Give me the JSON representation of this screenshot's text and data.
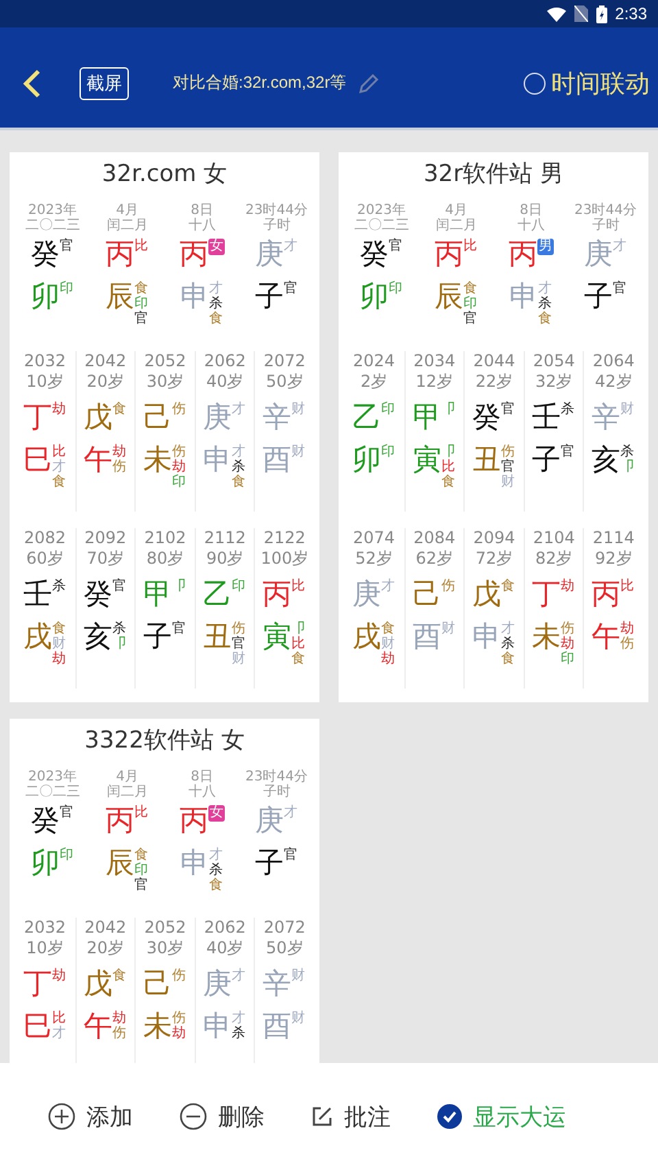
{
  "status_bar": {
    "time": "2:33"
  },
  "header": {
    "screenshot_button": "截屏",
    "title": "对比合婚:32r.com,32r等",
    "time_link": {
      "label": "时间联动",
      "checked": false
    }
  },
  "cards": [
    {
      "title": "32r.com 女",
      "pillars": [
        {
          "lines": [
            "2023年",
            "二〇二三"
          ],
          "stem": {
            "char": "癸",
            "color": "#111111",
            "tags": [
              {
                "text": "官",
                "color": "#333333"
              }
            ]
          },
          "branch": {
            "char": "卯",
            "color": "#1e9a1e",
            "tags": [
              {
                "text": "印",
                "color": "#3aa63a"
              }
            ]
          }
        },
        {
          "lines": [
            "4月",
            "闰二月"
          ],
          "stem": {
            "char": "丙",
            "color": "#e8262a",
            "tags": [
              {
                "text": "比",
                "color": "#e8262a"
              }
            ]
          },
          "branch": {
            "char": "辰",
            "color": "#a06c12",
            "tags": [
              {
                "text": "食",
                "color": "#b08030"
              },
              {
                "text": "印",
                "color": "#3aa63a"
              },
              {
                "text": "官",
                "color": "#333333"
              }
            ]
          }
        },
        {
          "lines": [
            "8日",
            "十八"
          ],
          "stem": {
            "char": "丙",
            "color": "#e8262a",
            "badge": {
              "text": "女",
              "color": "#e0409a"
            }
          },
          "branch": {
            "char": "申",
            "color": "#98a4b8",
            "tags": [
              {
                "text": "才",
                "color": "#a0aac0"
              },
              {
                "text": "杀",
                "color": "#222222"
              },
              {
                "text": "食",
                "color": "#b08030"
              }
            ]
          }
        },
        {
          "lines": [
            "23时44分",
            "子时"
          ],
          "stem": {
            "char": "庚",
            "color": "#98a4b8",
            "tags": [
              {
                "text": "才",
                "color": "#a0aac0"
              }
            ]
          },
          "branch": {
            "char": "子",
            "color": "#111111",
            "tags": [
              {
                "text": "官",
                "color": "#333333"
              }
            ]
          }
        }
      ],
      "dayun": [
        [
          {
            "year": "2032",
            "age": "10岁",
            "stem": {
              "char": "丁",
              "color": "#e8262a",
              "tags": [
                {
                  "text": "劫",
                  "color": "#e8262a"
                }
              ]
            },
            "branch": {
              "char": "巳",
              "color": "#e8262a",
              "tags": [
                {
                  "text": "比",
                  "color": "#e8262a"
                },
                {
                  "text": "才",
                  "color": "#a0aac0"
                },
                {
                  "text": "食",
                  "color": "#b08030"
                }
              ]
            }
          },
          {
            "year": "2042",
            "age": "20岁",
            "stem": {
              "char": "戊",
              "color": "#a06c12",
              "tags": [
                {
                  "text": "食",
                  "color": "#b08030"
                }
              ]
            },
            "branch": {
              "char": "午",
              "color": "#e8262a",
              "tags": [
                {
                  "text": "劫",
                  "color": "#e8262a"
                },
                {
                  "text": "伤",
                  "color": "#b08030"
                }
              ]
            }
          },
          {
            "year": "2052",
            "age": "30岁",
            "stem": {
              "char": "己",
              "color": "#a06c12",
              "tags": [
                {
                  "text": "伤",
                  "color": "#b08030"
                }
              ]
            },
            "branch": {
              "char": "未",
              "color": "#a06c12",
              "tags": [
                {
                  "text": "伤",
                  "color": "#b08030"
                },
                {
                  "text": "劫",
                  "color": "#e8262a"
                },
                {
                  "text": "印",
                  "color": "#3aa63a"
                }
              ]
            }
          },
          {
            "year": "2062",
            "age": "40岁",
            "stem": {
              "char": "庚",
              "color": "#98a4b8",
              "tags": [
                {
                  "text": "才",
                  "color": "#a0aac0"
                }
              ]
            },
            "branch": {
              "char": "申",
              "color": "#98a4b8",
              "tags": [
                {
                  "text": "才",
                  "color": "#a0aac0"
                },
                {
                  "text": "杀",
                  "color": "#222222"
                },
                {
                  "text": "食",
                  "color": "#b08030"
                }
              ]
            }
          },
          {
            "year": "2072",
            "age": "50岁",
            "stem": {
              "char": "辛",
              "color": "#98a4b8",
              "tags": [
                {
                  "text": "财",
                  "color": "#a0aac0"
                }
              ]
            },
            "branch": {
              "char": "酉",
              "color": "#98a4b8",
              "tags": [
                {
                  "text": "财",
                  "color": "#a0aac0"
                }
              ]
            }
          }
        ],
        [
          {
            "year": "2082",
            "age": "60岁",
            "stem": {
              "char": "壬",
              "color": "#111111",
              "tags": [
                {
                  "text": "杀",
                  "color": "#222222"
                }
              ]
            },
            "branch": {
              "char": "戌",
              "color": "#a06c12",
              "tags": [
                {
                  "text": "食",
                  "color": "#b08030"
                },
                {
                  "text": "财",
                  "color": "#a0aac0"
                },
                {
                  "text": "劫",
                  "color": "#e8262a"
                }
              ]
            }
          },
          {
            "year": "2092",
            "age": "70岁",
            "stem": {
              "char": "癸",
              "color": "#111111",
              "tags": [
                {
                  "text": "官",
                  "color": "#333333"
                }
              ]
            },
            "branch": {
              "char": "亥",
              "color": "#111111",
              "tags": [
                {
                  "text": "杀",
                  "color": "#222222"
                },
                {
                  "text": "卩",
                  "color": "#3aa63a"
                }
              ]
            }
          },
          {
            "year": "2102",
            "age": "80岁",
            "stem": {
              "char": "甲",
              "color": "#1e9a1e",
              "tags": [
                {
                  "text": "卩",
                  "color": "#3aa63a"
                }
              ]
            },
            "branch": {
              "char": "子",
              "color": "#111111",
              "tags": [
                {
                  "text": "官",
                  "color": "#333333"
                }
              ]
            }
          },
          {
            "year": "2112",
            "age": "90岁",
            "stem": {
              "char": "乙",
              "color": "#1e9a1e",
              "tags": [
                {
                  "text": "印",
                  "color": "#3aa63a"
                }
              ]
            },
            "branch": {
              "char": "丑",
              "color": "#a06c12",
              "tags": [
                {
                  "text": "伤",
                  "color": "#b08030"
                },
                {
                  "text": "官",
                  "color": "#333333"
                },
                {
                  "text": "财",
                  "color": "#a0aac0"
                }
              ]
            }
          },
          {
            "year": "2122",
            "age": "100岁",
            "stem": {
              "char": "丙",
              "color": "#e8262a",
              "tags": [
                {
                  "text": "比",
                  "color": "#e8262a"
                }
              ]
            },
            "branch": {
              "char": "寅",
              "color": "#1e9a1e",
              "tags": [
                {
                  "text": "卩",
                  "color": "#3aa63a"
                },
                {
                  "text": "比",
                  "color": "#e8262a"
                },
                {
                  "text": "食",
                  "color": "#b08030"
                }
              ]
            }
          }
        ]
      ]
    },
    {
      "title": "32r软件站 男",
      "pillars": [
        {
          "lines": [
            "2023年",
            "二〇二三"
          ],
          "stem": {
            "char": "癸",
            "color": "#111111",
            "tags": [
              {
                "text": "官",
                "color": "#333333"
              }
            ]
          },
          "branch": {
            "char": "卯",
            "color": "#1e9a1e",
            "tags": [
              {
                "text": "印",
                "color": "#3aa63a"
              }
            ]
          }
        },
        {
          "lines": [
            "4月",
            "闰二月"
          ],
          "stem": {
            "char": "丙",
            "color": "#e8262a",
            "tags": [
              {
                "text": "比",
                "color": "#e8262a"
              }
            ]
          },
          "branch": {
            "char": "辰",
            "color": "#a06c12",
            "tags": [
              {
                "text": "食",
                "color": "#b08030"
              },
              {
                "text": "印",
                "color": "#3aa63a"
              },
              {
                "text": "官",
                "color": "#333333"
              }
            ]
          }
        },
        {
          "lines": [
            "8日",
            "十八"
          ],
          "stem": {
            "char": "丙",
            "color": "#e8262a",
            "badge": {
              "text": "男",
              "color": "#3a7ae0"
            }
          },
          "branch": {
            "char": "申",
            "color": "#98a4b8",
            "tags": [
              {
                "text": "才",
                "color": "#a0aac0"
              },
              {
                "text": "杀",
                "color": "#222222"
              },
              {
                "text": "食",
                "color": "#b08030"
              }
            ]
          }
        },
        {
          "lines": [
            "23时44分",
            "子时"
          ],
          "stem": {
            "char": "庚",
            "color": "#98a4b8",
            "tags": [
              {
                "text": "才",
                "color": "#a0aac0"
              }
            ]
          },
          "branch": {
            "char": "子",
            "color": "#111111",
            "tags": [
              {
                "text": "官",
                "color": "#333333"
              }
            ]
          }
        }
      ],
      "dayun": [
        [
          {
            "year": "2024",
            "age": "2岁",
            "stem": {
              "char": "乙",
              "color": "#1e9a1e",
              "tags": [
                {
                  "text": "印",
                  "color": "#3aa63a"
                }
              ]
            },
            "branch": {
              "char": "卯",
              "color": "#1e9a1e",
              "tags": [
                {
                  "text": "印",
                  "color": "#3aa63a"
                }
              ]
            }
          },
          {
            "year": "2034",
            "age": "12岁",
            "stem": {
              "char": "甲",
              "color": "#1e9a1e",
              "tags": [
                {
                  "text": "卩",
                  "color": "#3aa63a"
                }
              ]
            },
            "branch": {
              "char": "寅",
              "color": "#1e9a1e",
              "tags": [
                {
                  "text": "卩",
                  "color": "#3aa63a"
                },
                {
                  "text": "比",
                  "color": "#e8262a"
                },
                {
                  "text": "食",
                  "color": "#b08030"
                }
              ]
            }
          },
          {
            "year": "2044",
            "age": "22岁",
            "stem": {
              "char": "癸",
              "color": "#111111",
              "tags": [
                {
                  "text": "官",
                  "color": "#333333"
                }
              ]
            },
            "branch": {
              "char": "丑",
              "color": "#a06c12",
              "tags": [
                {
                  "text": "伤",
                  "color": "#b08030"
                },
                {
                  "text": "官",
                  "color": "#333333"
                },
                {
                  "text": "财",
                  "color": "#a0aac0"
                }
              ]
            }
          },
          {
            "year": "2054",
            "age": "32岁",
            "stem": {
              "char": "壬",
              "color": "#111111",
              "tags": [
                {
                  "text": "杀",
                  "color": "#222222"
                }
              ]
            },
            "branch": {
              "char": "子",
              "color": "#111111",
              "tags": [
                {
                  "text": "官",
                  "color": "#333333"
                }
              ]
            }
          },
          {
            "year": "2064",
            "age": "42岁",
            "stem": {
              "char": "辛",
              "color": "#98a4b8",
              "tags": [
                {
                  "text": "财",
                  "color": "#a0aac0"
                }
              ]
            },
            "branch": {
              "char": "亥",
              "color": "#111111",
              "tags": [
                {
                  "text": "杀",
                  "color": "#222222"
                },
                {
                  "text": "卩",
                  "color": "#3aa63a"
                }
              ]
            }
          }
        ],
        [
          {
            "year": "2074",
            "age": "52岁",
            "stem": {
              "char": "庚",
              "color": "#98a4b8",
              "tags": [
                {
                  "text": "才",
                  "color": "#a0aac0"
                }
              ]
            },
            "branch": {
              "char": "戌",
              "color": "#a06c12",
              "tags": [
                {
                  "text": "食",
                  "color": "#b08030"
                },
                {
                  "text": "财",
                  "color": "#a0aac0"
                },
                {
                  "text": "劫",
                  "color": "#e8262a"
                }
              ]
            }
          },
          {
            "year": "2084",
            "age": "62岁",
            "stem": {
              "char": "己",
              "color": "#a06c12",
              "tags": [
                {
                  "text": "伤",
                  "color": "#b08030"
                }
              ]
            },
            "branch": {
              "char": "酉",
              "color": "#98a4b8",
              "tags": [
                {
                  "text": "财",
                  "color": "#a0aac0"
                }
              ]
            }
          },
          {
            "year": "2094",
            "age": "72岁",
            "stem": {
              "char": "戊",
              "color": "#a06c12",
              "tags": [
                {
                  "text": "食",
                  "color": "#b08030"
                }
              ]
            },
            "branch": {
              "char": "申",
              "color": "#98a4b8",
              "tags": [
                {
                  "text": "才",
                  "color": "#a0aac0"
                },
                {
                  "text": "杀",
                  "color": "#222222"
                },
                {
                  "text": "食",
                  "color": "#b08030"
                }
              ]
            }
          },
          {
            "year": "2104",
            "age": "82岁",
            "stem": {
              "char": "丁",
              "color": "#e8262a",
              "tags": [
                {
                  "text": "劫",
                  "color": "#e8262a"
                }
              ]
            },
            "branch": {
              "char": "未",
              "color": "#a06c12",
              "tags": [
                {
                  "text": "伤",
                  "color": "#b08030"
                },
                {
                  "text": "劫",
                  "color": "#e8262a"
                },
                {
                  "text": "印",
                  "color": "#3aa63a"
                }
              ]
            }
          },
          {
            "year": "2114",
            "age": "92岁",
            "stem": {
              "char": "丙",
              "color": "#e8262a",
              "tags": [
                {
                  "text": "比",
                  "color": "#e8262a"
                }
              ]
            },
            "branch": {
              "char": "午",
              "color": "#e8262a",
              "tags": [
                {
                  "text": "劫",
                  "color": "#e8262a"
                },
                {
                  "text": "伤",
                  "color": "#b08030"
                }
              ]
            }
          }
        ]
      ]
    },
    {
      "title": "3322软件站 女",
      "pillars": [
        {
          "lines": [
            "2023年",
            "二〇二三"
          ],
          "stem": {
            "char": "癸",
            "color": "#111111",
            "tags": [
              {
                "text": "官",
                "color": "#333333"
              }
            ]
          },
          "branch": {
            "char": "卯",
            "color": "#1e9a1e",
            "tags": [
              {
                "text": "印",
                "color": "#3aa63a"
              }
            ]
          }
        },
        {
          "lines": [
            "4月",
            "闰二月"
          ],
          "stem": {
            "char": "丙",
            "color": "#e8262a",
            "tags": [
              {
                "text": "比",
                "color": "#e8262a"
              }
            ]
          },
          "branch": {
            "char": "辰",
            "color": "#a06c12",
            "tags": [
              {
                "text": "食",
                "color": "#b08030"
              },
              {
                "text": "印",
                "color": "#3aa63a"
              },
              {
                "text": "官",
                "color": "#333333"
              }
            ]
          }
        },
        {
          "lines": [
            "8日",
            "十八"
          ],
          "stem": {
            "char": "丙",
            "color": "#e8262a",
            "badge": {
              "text": "女",
              "color": "#e0409a"
            }
          },
          "branch": {
            "char": "申",
            "color": "#98a4b8",
            "tags": [
              {
                "text": "才",
                "color": "#a0aac0"
              },
              {
                "text": "杀",
                "color": "#222222"
              },
              {
                "text": "食",
                "color": "#b08030"
              }
            ]
          }
        },
        {
          "lines": [
            "23时44分",
            "子时"
          ],
          "stem": {
            "char": "庚",
            "color": "#98a4b8",
            "tags": [
              {
                "text": "才",
                "color": "#a0aac0"
              }
            ]
          },
          "branch": {
            "char": "子",
            "color": "#111111",
            "tags": [
              {
                "text": "官",
                "color": "#333333"
              }
            ]
          }
        }
      ],
      "dayun": [
        [
          {
            "year": "2032",
            "age": "10岁",
            "stem": {
              "char": "丁",
              "color": "#e8262a",
              "tags": [
                {
                  "text": "劫",
                  "color": "#e8262a"
                }
              ]
            },
            "branch": {
              "char": "巳",
              "color": "#e8262a",
              "tags": [
                {
                  "text": "比",
                  "color": "#e8262a"
                },
                {
                  "text": "才",
                  "color": "#a0aac0"
                }
              ]
            }
          },
          {
            "year": "2042",
            "age": "20岁",
            "stem": {
              "char": "戊",
              "color": "#a06c12",
              "tags": [
                {
                  "text": "食",
                  "color": "#b08030"
                }
              ]
            },
            "branch": {
              "char": "午",
              "color": "#e8262a",
              "tags": [
                {
                  "text": "劫",
                  "color": "#e8262a"
                },
                {
                  "text": "伤",
                  "color": "#b08030"
                }
              ]
            }
          },
          {
            "year": "2052",
            "age": "30岁",
            "stem": {
              "char": "己",
              "color": "#a06c12",
              "tags": [
                {
                  "text": "伤",
                  "color": "#b08030"
                }
              ]
            },
            "branch": {
              "char": "未",
              "color": "#a06c12",
              "tags": [
                {
                  "text": "伤",
                  "color": "#b08030"
                },
                {
                  "text": "劫",
                  "color": "#e8262a"
                }
              ]
            }
          },
          {
            "year": "2062",
            "age": "40岁",
            "stem": {
              "char": "庚",
              "color": "#98a4b8",
              "tags": [
                {
                  "text": "才",
                  "color": "#a0aac0"
                }
              ]
            },
            "branch": {
              "char": "申",
              "color": "#98a4b8",
              "tags": [
                {
                  "text": "才",
                  "color": "#a0aac0"
                },
                {
                  "text": "杀",
                  "color": "#222222"
                }
              ]
            }
          },
          {
            "year": "2072",
            "age": "50岁",
            "stem": {
              "char": "辛",
              "color": "#98a4b8",
              "tags": [
                {
                  "text": "财",
                  "color": "#a0aac0"
                }
              ]
            },
            "branch": {
              "char": "酉",
              "color": "#98a4b8",
              "tags": [
                {
                  "text": "财",
                  "color": "#a0aac0"
                }
              ]
            }
          }
        ]
      ]
    }
  ],
  "bottom_bar": [
    {
      "kind": "add",
      "label": "添加"
    },
    {
      "kind": "remove",
      "label": "删除"
    },
    {
      "kind": "note",
      "label": "批注"
    },
    {
      "kind": "check",
      "label": "显示大运",
      "checked": true
    }
  ]
}
